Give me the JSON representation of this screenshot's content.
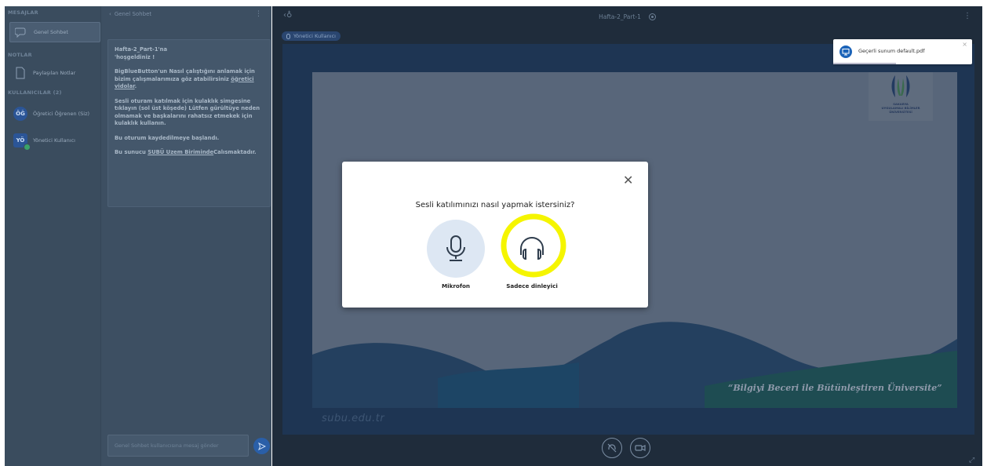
{
  "left_panel": {
    "messages_title": "MESAJLAR",
    "public_chat_label": "Genel Sohbet",
    "notes_title": "NOTLAR",
    "shared_notes_label": "Paylaşılan Notlar",
    "users_title": "KULLANICILAR (2)",
    "users": [
      {
        "initials": "ÖĞ",
        "name": "Öğretici Öğrenen (Siz)"
      },
      {
        "initials": "YÖ",
        "name": "Yönetici Kullanıcı"
      }
    ]
  },
  "chat": {
    "header": "Genel Sohbet",
    "welcome_line1": "Hafta-2_Part-1'na",
    "welcome_line2": "'hoşgeldiniz !",
    "help_text": "BigBlueButton'un Nasıl çalıştığını anlamak için bizim çalışmalarımıza göz atabilirsiniz",
    "help_link": "öğretici vidolar",
    "help_end": ".",
    "audio_text": "Sesli oturam katılmak için kulaklık simgesine tıklayın (sol üst köşede) Lütfen gürültüye neden olmamak ve başkalarını rahatsız etmekek için kulaklık kullanın.",
    "recording_text": "Bu oturum kaydedilmeye başlandı.",
    "server_text_pre": "Bu sunucu",
    "server_link": "SUBÜ Uzem Biriminde",
    "server_text_post": "Calısmaktadır.",
    "input_placeholder": "Genel Sohbet kullanıcısına mesaj gönder"
  },
  "presentation": {
    "title": "Hafta-2_Part-1",
    "presenter_badge": "Yönetici Kullanıcı",
    "logo_line1": "SAKARYA",
    "logo_line2": "UYGULAMALI BİLİMLER",
    "logo_line3": "ÜNİVERSİTESİ",
    "quote": "“Bilgiyi Beceri ile Bütünleştiren Üniversite”",
    "url": "subu.edu.tr"
  },
  "toast": {
    "text": "Geçerli sunum default.pdf"
  },
  "modal": {
    "title": "Sesli katılımınızı nasıl yapmak istersiniz?",
    "mic_label": "Mikrofon",
    "listen_label": "Sadece dinleyici"
  },
  "colors": {
    "highlight": "#f5f500",
    "accent": "#1b63b8"
  }
}
